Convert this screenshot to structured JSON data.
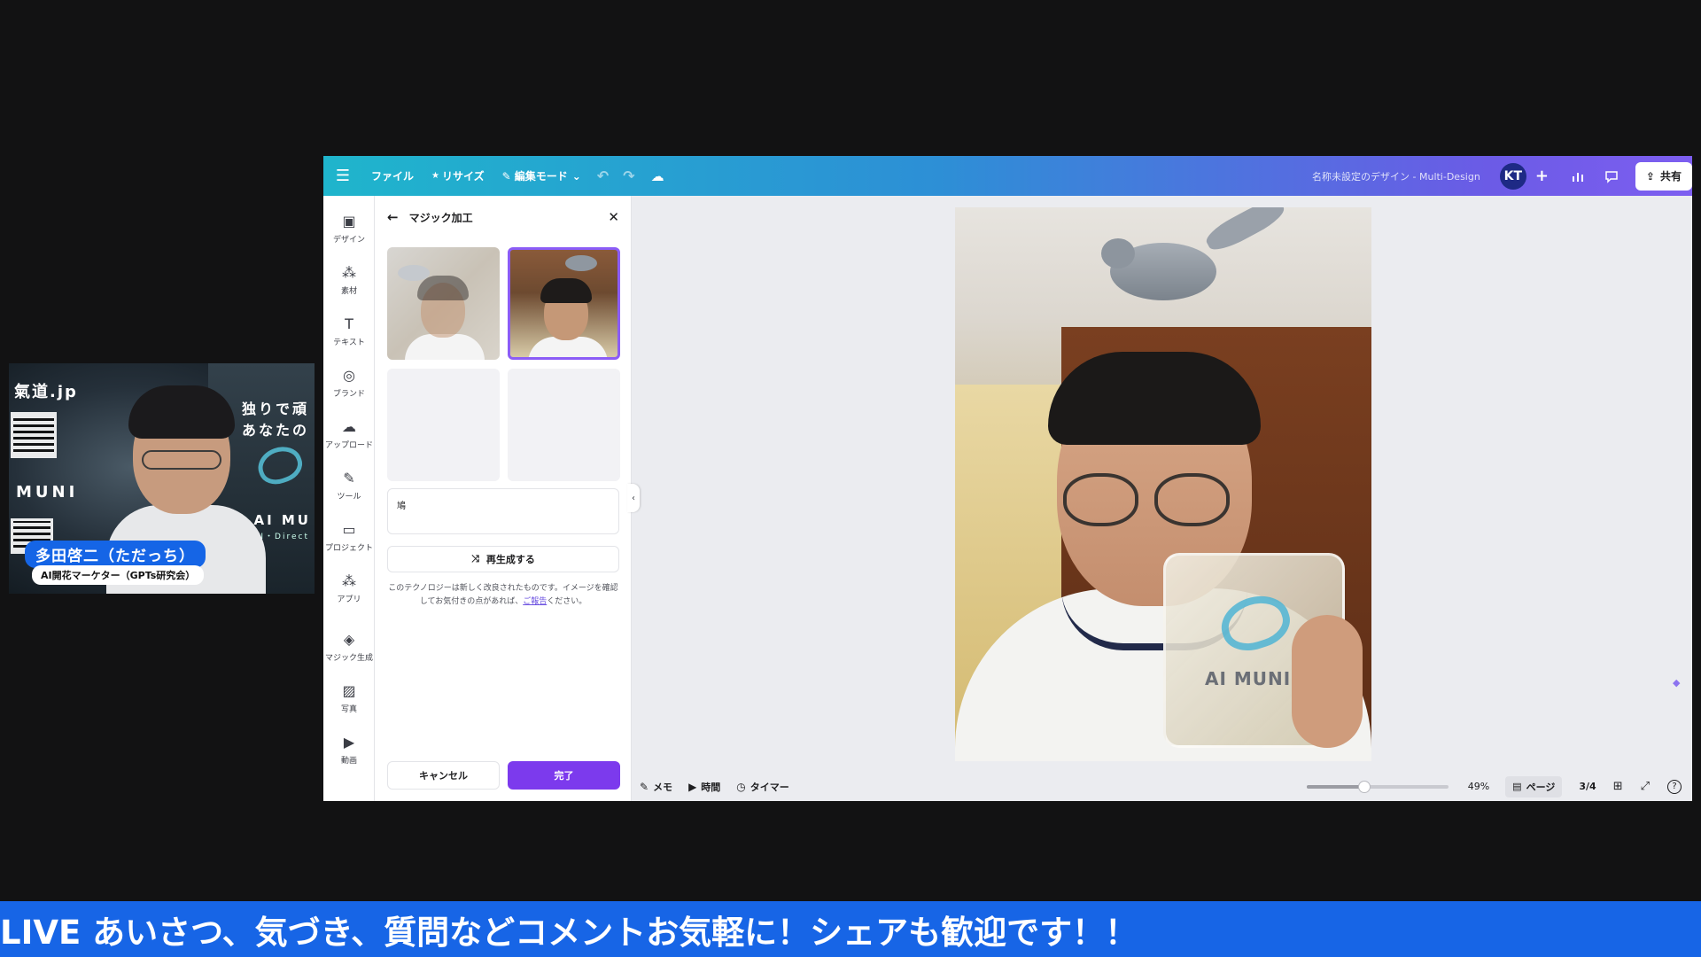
{
  "webcam": {
    "brand_top": "氣道.jp",
    "muni": "MUNI",
    "right_line1": "独りで頑",
    "right_line2": "あなたの",
    "ai_mu": "AI MU",
    "ai_direct": "AI・Direct",
    "name": "多田啓二（ただっち）",
    "subtitle": "AI開花マーケター（GPTs研究会）"
  },
  "topbar": {
    "menu_icon": "hamburger-icon",
    "file": "ファイル",
    "resize": "リサイズ",
    "resize_icon": "★",
    "edit_mode": "編集モード",
    "edit_icon": "✎",
    "chevron": "⌄",
    "undo": "↶",
    "redo": "↷",
    "cloud": "☁",
    "doc_title": "名称未設定のデザイン - Multi-Design",
    "avatar": "KT",
    "plus": "+",
    "chart_icon": "📊",
    "comment_icon": "💬",
    "share_icon": "⇪",
    "share": "共有"
  },
  "rail": {
    "items": [
      {
        "icon": "▣",
        "label": "デザイン"
      },
      {
        "icon": "⁂",
        "label": "素材"
      },
      {
        "icon": "T",
        "label": "テキスト"
      },
      {
        "icon": "◎",
        "label": "ブランド"
      },
      {
        "icon": "☁",
        "label": "アップロード"
      },
      {
        "icon": "✎",
        "label": "ツール"
      },
      {
        "icon": "▭",
        "label": "プロジェクト"
      },
      {
        "icon": "⁂",
        "label": "アプリ"
      },
      {
        "icon": "◈",
        "label": "マジック生成"
      },
      {
        "icon": "▨",
        "label": "写真"
      },
      {
        "icon": "▶",
        "label": "動画"
      }
    ]
  },
  "panel": {
    "back": "←",
    "title": "マジック加工",
    "close": "✕",
    "prompt_text": "鳩",
    "regen_icon": "⤨",
    "regen": "再生成する",
    "disclaimer_pre": "このテクノロジーは新しく改良されたものです。イメージを確認してお気付きの点があれば、",
    "disclaimer_link": "ご報告",
    "disclaimer_post": "ください。",
    "cancel": "キャンセル",
    "done": "完了",
    "collapse": "‹"
  },
  "photo": {
    "glass_text": "AI MUNI"
  },
  "bottombar": {
    "notes_icon": "✎",
    "notes": "メモ",
    "time_icon": "▶",
    "time": "時間",
    "timer_icon": "◷",
    "timer": "タイマー",
    "zoom": "49%",
    "zoom_level": 0.41,
    "pages_icon": "▤",
    "pages": "ページ",
    "page_count": "3/4",
    "grid_icon": "⊞",
    "fullscreen_icon": "⤢",
    "help_icon": "?"
  },
  "ticker": {
    "text": "LIVE あいさつ、気づき、質問などコメントお気軽に！シェアも歓迎です！！"
  },
  "colors": {
    "accent": "#7c3aed",
    "ticker_bg": "#1765e6",
    "topbar_start": "#1fb5cc",
    "topbar_end": "#7d5ef0"
  }
}
